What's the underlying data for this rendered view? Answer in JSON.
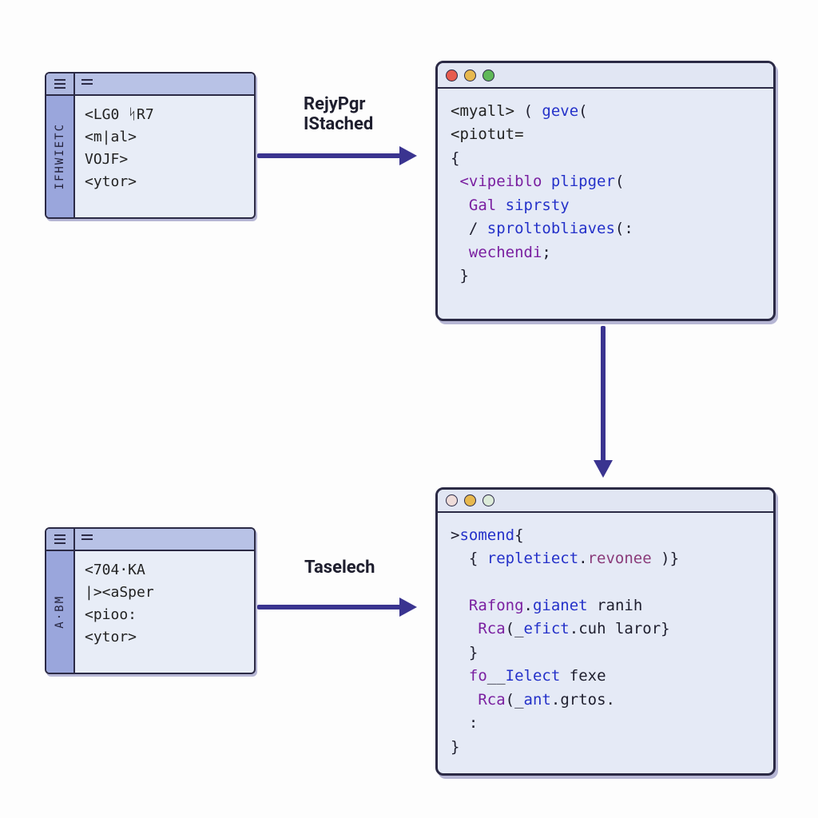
{
  "panels": {
    "top_left": {
      "gutter": "IFHWIETC",
      "code": "<LG0 ᛋR7\n<m|al>\nVOJF>\n<ytor>"
    },
    "bottom_left": {
      "gutter": "A·BM",
      "code": "<704·KА\n|><aSper\n<pioo:\n<ytor>"
    }
  },
  "arrows": {
    "top": {
      "line1": "RejyPgr",
      "line2": "IStached"
    },
    "bottom": {
      "line1": "Taselech"
    }
  },
  "windows": {
    "top_right": {
      "code_tokens": [
        {
          "cls": "tag",
          "t": "<myall>"
        },
        {
          "cls": "plain",
          "t": " ( "
        },
        {
          "cls": "fn",
          "t": "geve"
        },
        {
          "cls": "plain",
          "t": "(\n"
        },
        {
          "cls": "tag",
          "t": "<piotut="
        },
        {
          "cls": "plain",
          "t": "\n{\n "
        },
        {
          "cls": "kw",
          "t": "<vipeiblo"
        },
        {
          "cls": "plain",
          "t": " "
        },
        {
          "cls": "fn",
          "t": "plipger"
        },
        {
          "cls": "plain",
          "t": "(\n  "
        },
        {
          "cls": "kw",
          "t": "Gal"
        },
        {
          "cls": "plain",
          "t": " "
        },
        {
          "cls": "fn",
          "t": "siprsty"
        },
        {
          "cls": "plain",
          "t": "\n  / "
        },
        {
          "cls": "fn",
          "t": "sproltobliaves"
        },
        {
          "cls": "plain",
          "t": "(:\n  "
        },
        {
          "cls": "kw",
          "t": "wechendi"
        },
        {
          "cls": "plain",
          "t": ";\n }"
        }
      ]
    },
    "bottom_right": {
      "code_tokens": [
        {
          "cls": "plain",
          "t": ">"
        },
        {
          "cls": "fn",
          "t": "somend"
        },
        {
          "cls": "plain",
          "t": "{\n  { "
        },
        {
          "cls": "fn",
          "t": "repletiect"
        },
        {
          "cls": "plain",
          "t": "."
        },
        {
          "cls": "str",
          "t": "revonee"
        },
        {
          "cls": "plain",
          "t": " )}\n\n  "
        },
        {
          "cls": "kw",
          "t": "Rafong"
        },
        {
          "cls": "plain",
          "t": "."
        },
        {
          "cls": "fn",
          "t": "gianet"
        },
        {
          "cls": "plain",
          "t": " ranih\n   "
        },
        {
          "cls": "kw",
          "t": "Rca"
        },
        {
          "cls": "plain",
          "t": "(_"
        },
        {
          "cls": "fn",
          "t": "efict"
        },
        {
          "cls": "plain",
          "t": ".cuh laror}\n  }\n  "
        },
        {
          "cls": "kw",
          "t": "fo"
        },
        {
          "cls": "plain",
          "t": "__"
        },
        {
          "cls": "fn",
          "t": "Ielect"
        },
        {
          "cls": "plain",
          "t": " fexe\n   "
        },
        {
          "cls": "kw",
          "t": "Rca"
        },
        {
          "cls": "plain",
          "t": "(_"
        },
        {
          "cls": "fn",
          "t": "ant"
        },
        {
          "cls": "plain",
          "t": ".grtos.\n  :\n}"
        }
      ]
    }
  }
}
